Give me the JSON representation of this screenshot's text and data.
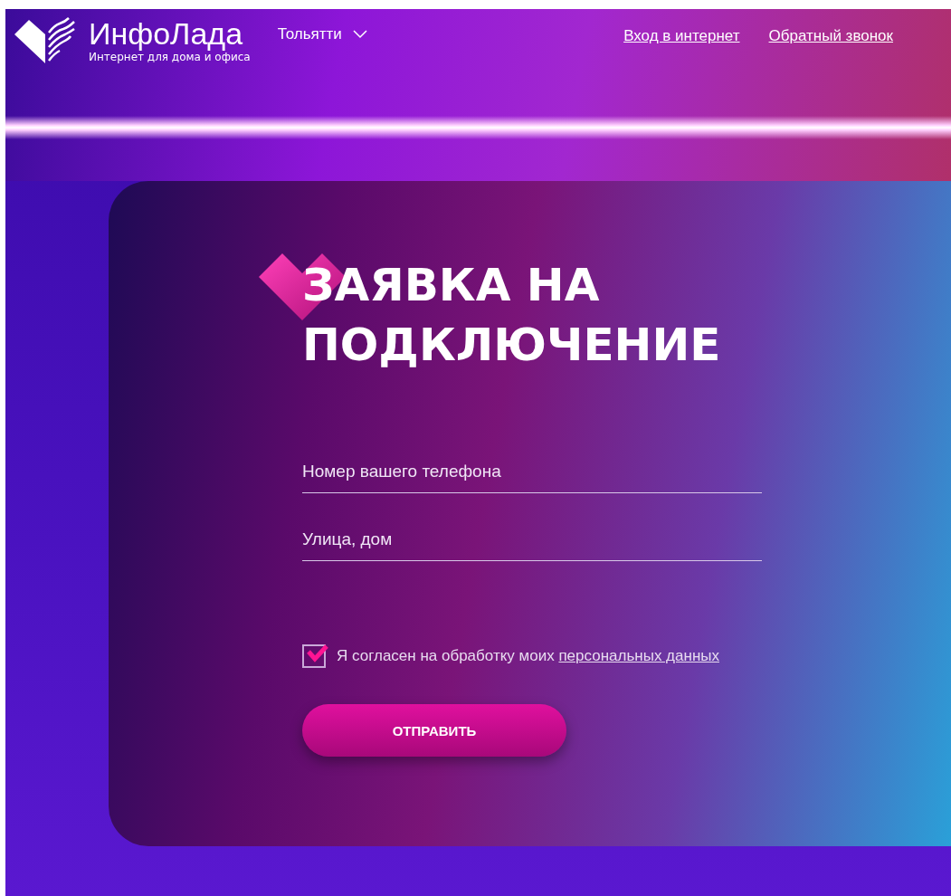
{
  "header": {
    "logo": {
      "name": "ИнфоЛада",
      "tagline": "Интернет для дома и офиса"
    },
    "city": "Тольятти",
    "links": [
      "Вход в интернет",
      "Обратный звонок"
    ]
  },
  "form": {
    "title": "ЗАЯВКА НА ПОДКЛЮЧЕНИЕ",
    "fields": [
      {
        "placeholder": "Номер вашего телефона"
      },
      {
        "placeholder": "Улица, дом"
      }
    ],
    "consent": {
      "checked": true,
      "text": "Я согласен на обработку моих",
      "link": "персональных данных"
    },
    "submit": "ОТПРАВИТЬ"
  }
}
